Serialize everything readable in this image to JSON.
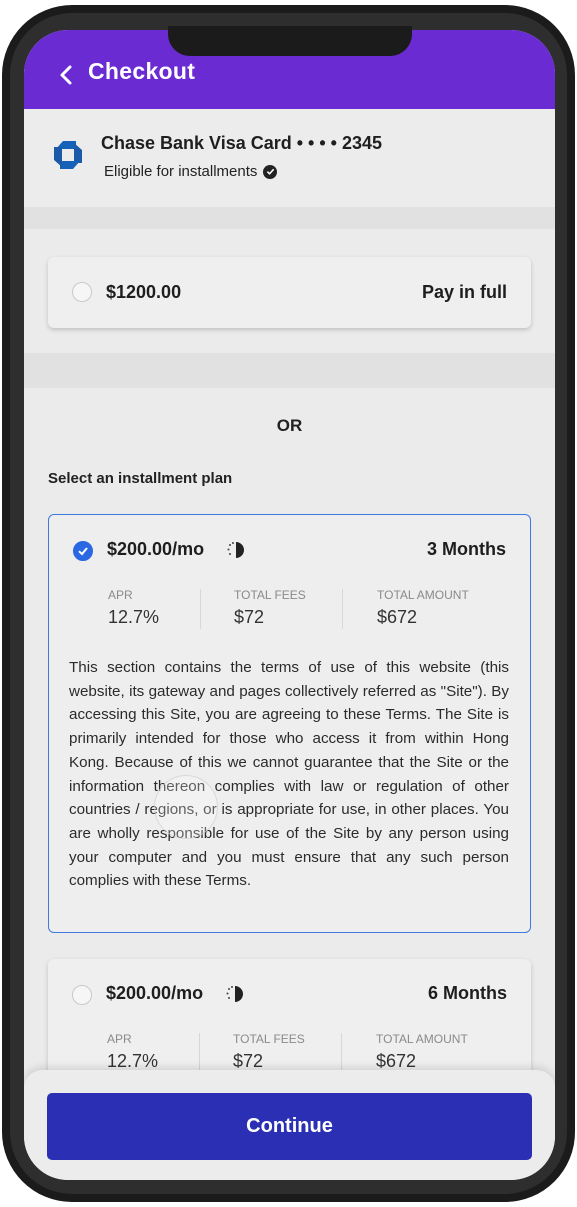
{
  "header": {
    "title": "Checkout",
    "back_icon": "chevron-left-icon"
  },
  "card": {
    "bank_logo": "chase-logo-icon",
    "name": "Chase Bank Visa Card  • • • • 2345",
    "eligibility": "Eligible for installments",
    "eligibility_icon": "check-circle-icon"
  },
  "pay_full": {
    "amount": "$1200.00",
    "label": "Pay in full",
    "selected": false
  },
  "or_text": "OR",
  "plans_label": "Select an installment plan",
  "plans": [
    {
      "amount": "$200.00/mo",
      "loading_icon": "spinner-icon",
      "duration": "3 Months",
      "selected": true,
      "apr_label": "APR",
      "apr_value": "12.7%",
      "fees_label": "TOTAL FEES",
      "fees_value": "$72",
      "total_label": "TOTAL AMOUNT",
      "total_value": "$672",
      "terms": "This section contains the terms of use of this website (this website, its gateway and pages collectively referred as \"Site\"). By accessing this Site, you are agreeing to these Terms. The Site is primarily intended for those who access it from within Hong Kong. Because of this we cannot guarantee that the Site or the information thereon complies with law or regulation of other countries / regions, or is appropriate for use, in other places. You are wholly responsible for use of the Site by any person using your computer and you must ensure that any such person complies with these Terms."
    },
    {
      "amount": "$200.00/mo",
      "loading_icon": "spinner-icon",
      "duration": "6 Months",
      "selected": false,
      "apr_label": "APR",
      "apr_value": "12.7%",
      "fees_label": "TOTAL FEES",
      "fees_value": "$72",
      "total_label": "TOTAL AMOUNT",
      "total_value": "$672"
    }
  ],
  "continue_label": "Continue",
  "colors": {
    "header": "#6a2bd2",
    "accent_blue": "#2a67e3",
    "button": "#2a2fb3"
  }
}
